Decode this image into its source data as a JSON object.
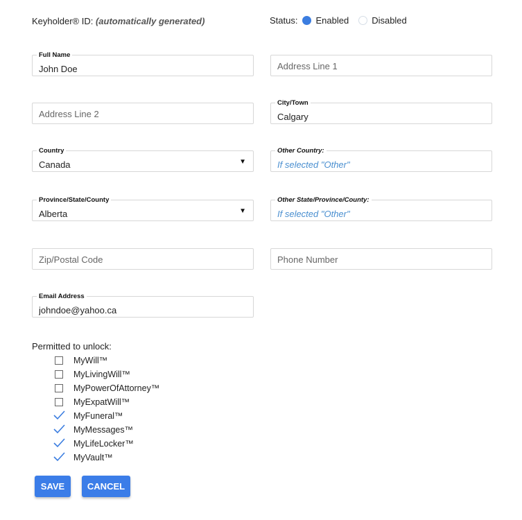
{
  "header": {
    "keyholder_label": "Keyholder® ID:",
    "keyholder_value": "(automatically generated)",
    "status_label": "Status:",
    "status_options": [
      {
        "label": "Enabled",
        "selected": true
      },
      {
        "label": "Disabled",
        "selected": false
      }
    ]
  },
  "fields": {
    "full_name": {
      "label": "Full Name",
      "value": "John Doe"
    },
    "address1": {
      "placeholder": "Address Line 1"
    },
    "address2": {
      "placeholder": "Address Line 2"
    },
    "city": {
      "label": "City/Town",
      "value": "Calgary"
    },
    "country": {
      "label": "Country",
      "value": "Canada"
    },
    "other_country": {
      "label": "Other Country:",
      "placeholder": "If selected \"Other\""
    },
    "province": {
      "label": "Province/State/County",
      "value": "Alberta"
    },
    "other_state": {
      "label": "Other State/Province/County:",
      "placeholder": "If selected \"Other\""
    },
    "zip": {
      "placeholder": "Zip/Postal Code"
    },
    "phone": {
      "placeholder": "Phone Number"
    },
    "email": {
      "label": "Email Address",
      "value": "johndoe@yahoo.ca"
    }
  },
  "permissions": {
    "title": "Permitted to unlock:",
    "items": [
      {
        "label": "MyWill™",
        "checked": false
      },
      {
        "label": "MyLivingWill™",
        "checked": false
      },
      {
        "label": "MyPowerOfAttorney™",
        "checked": false
      },
      {
        "label": "MyExpatWill™",
        "checked": false
      },
      {
        "label": "MyFuneral™",
        "checked": true
      },
      {
        "label": "MyMessages™",
        "checked": true
      },
      {
        "label": "MyLifeLocker™",
        "checked": true
      },
      {
        "label": "MyVault™",
        "checked": true
      }
    ]
  },
  "actions": {
    "save_label": "SAVE",
    "cancel_label": "CANCEL"
  },
  "colors": {
    "accent": "#3b7de8",
    "placeholder_hint": "#4a8fd0"
  }
}
